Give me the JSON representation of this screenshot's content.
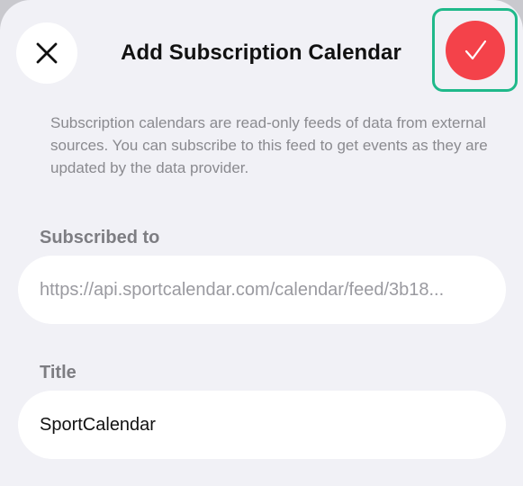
{
  "header": {
    "title": "Add Subscription Calendar",
    "close_icon": "close-icon",
    "confirm_icon": "checkmark-icon",
    "confirm_color": "#f4424a",
    "highlight_color": "#1fb98a"
  },
  "description": "Subscription calendars are read-only feeds of data from external sources. You can subscribe to this feed to get events as they are updated by the data provider.",
  "subscribed": {
    "label": "Subscribed to",
    "url": "https://api.sportcalendar.com/calendar/feed/3b18..."
  },
  "title_field": {
    "label": "Title",
    "value": "SportCalendar"
  }
}
